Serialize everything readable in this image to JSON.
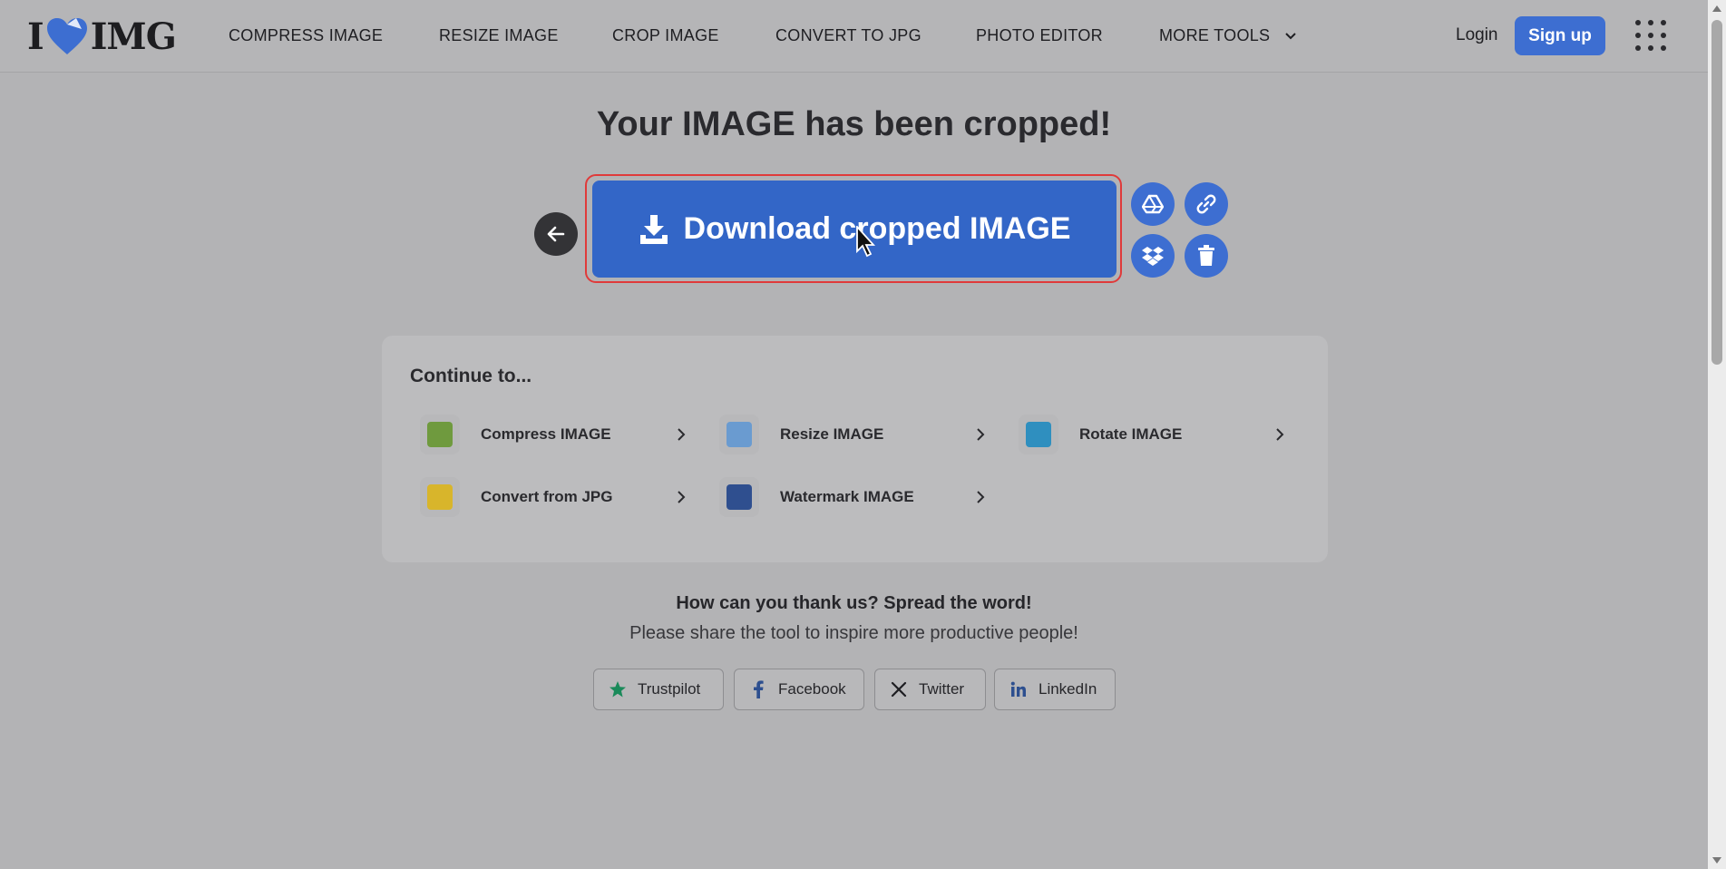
{
  "brand": {
    "logo_left": "I",
    "logo_right": "IMG"
  },
  "nav": {
    "items": [
      "COMPRESS IMAGE",
      "RESIZE IMAGE",
      "CROP IMAGE",
      "CONVERT TO JPG",
      "PHOTO EDITOR",
      "MORE TOOLS"
    ]
  },
  "auth": {
    "login": "Login",
    "signup": "Sign up"
  },
  "result": {
    "title": "Your IMAGE has been cropped!",
    "download_label": "Download cropped IMAGE"
  },
  "continue": {
    "title": "Continue to...",
    "tools": [
      {
        "label": "Compress IMAGE",
        "color": "#6f9a3e"
      },
      {
        "label": "Resize IMAGE",
        "color": "#6a9bd0"
      },
      {
        "label": "Rotate IMAGE",
        "color": "#2f8fbf"
      },
      {
        "label": "Convert from JPG",
        "color": "#d8b52b"
      },
      {
        "label": "Watermark IMAGE",
        "color": "#2f4f8f"
      }
    ]
  },
  "share": {
    "heading": "How can you thank us? Spread the word!",
    "subtext": "Please share the tool to inspire more productive people!",
    "buttons": [
      "Trustpilot",
      "Facebook",
      "Twitter",
      "LinkedIn"
    ]
  },
  "colors": {
    "accent": "#3d6ed1",
    "download": "#3366c7",
    "highlight": "#e03a3a"
  }
}
